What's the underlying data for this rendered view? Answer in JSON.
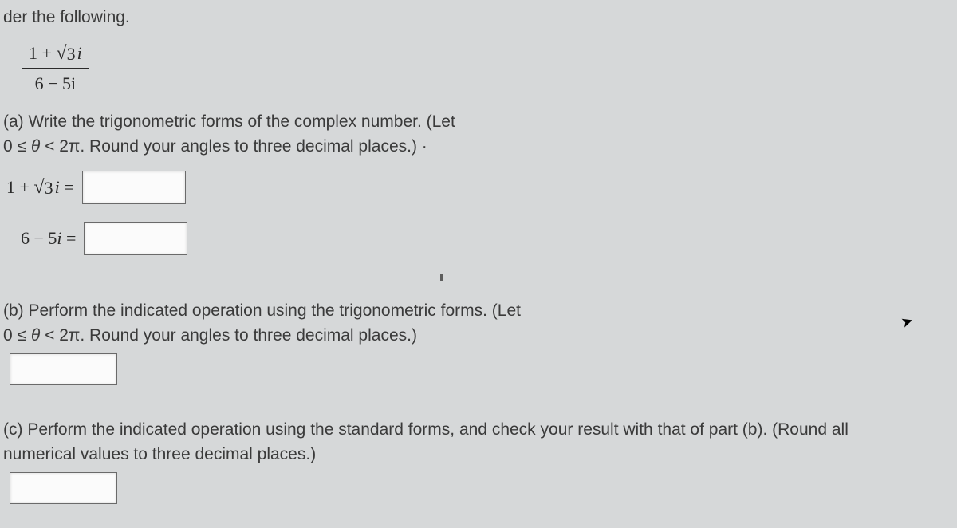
{
  "intro": "der the following.",
  "fraction": {
    "num_prefix": "1 + ",
    "num_radicand": "3",
    "num_suffix": "i",
    "den": "6 − 5i"
  },
  "partA": {
    "line1": "(a) Write the trigonometric forms of the complex number. (Let",
    "line2_prefix": "0 ≤ ",
    "line2_theta": "θ",
    "line2_suffix": " < 2π. Round your angles to three decimal places.)  ·",
    "eq1_prefix": "1 + ",
    "eq1_radicand": "3",
    "eq1_suffix": "i",
    "eq1_equals": " =",
    "eq2_lhs": "6 − 5",
    "eq2_i": "i",
    "eq2_equals": " ="
  },
  "partB": {
    "line1": "(b) Perform the indicated operation using the trigonometric forms. (Let",
    "line2_prefix": "0 ≤ ",
    "line2_theta": "θ",
    "line2_suffix": " < 2π. Round your angles to three decimal places.)"
  },
  "partC": {
    "line1": "(c) Perform the indicated operation using the standard forms, and check your result with that of part (b). (Round all",
    "line2": "numerical values to three decimal places.)"
  },
  "inputs": {
    "a1": "",
    "a2": "",
    "b": "",
    "c": ""
  }
}
